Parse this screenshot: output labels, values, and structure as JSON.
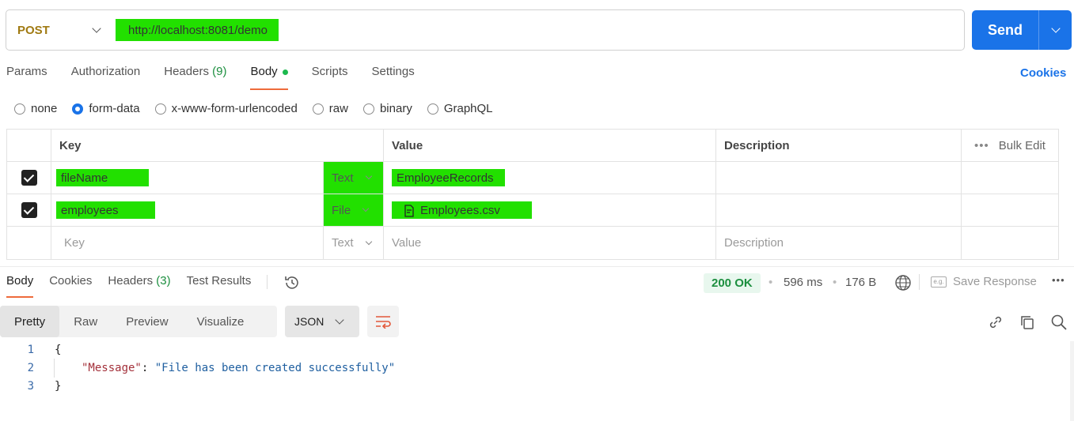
{
  "request": {
    "method": "POST",
    "url": "http://localhost:8081/demo",
    "send_label": "Send"
  },
  "tabs": [
    {
      "label": "Params"
    },
    {
      "label": "Authorization"
    },
    {
      "label": "Headers",
      "count": "(9)"
    },
    {
      "label": "Body",
      "active": true
    },
    {
      "label": "Scripts"
    },
    {
      "label": "Settings"
    }
  ],
  "cookies_label": "Cookies",
  "body_types": [
    "none",
    "form-data",
    "x-www-form-urlencoded",
    "raw",
    "binary",
    "GraphQL"
  ],
  "body_type_selected": "form-data",
  "form_table": {
    "headers": {
      "key": "Key",
      "value": "Value",
      "description": "Description",
      "bulk_edit": "Bulk Edit"
    },
    "rows": [
      {
        "key": "fileName",
        "type": "Text",
        "value": "EmployeeRecords",
        "checked": true
      },
      {
        "key": "employees",
        "type": "File",
        "value": "Employees.csv",
        "checked": true
      }
    ],
    "placeholder": {
      "key": "Key",
      "type": "Text",
      "value": "Value",
      "description": "Description"
    }
  },
  "response": {
    "tabs": [
      {
        "label": "Body",
        "active": true
      },
      {
        "label": "Cookies"
      },
      {
        "label": "Headers",
        "count": "(3)"
      },
      {
        "label": "Test Results"
      }
    ],
    "status": "200 OK",
    "time": "596 ms",
    "size": "176 B",
    "save_label": "Save Response",
    "eg_label": "e.g.",
    "view_tabs": [
      "Pretty",
      "Raw",
      "Preview",
      "Visualize"
    ],
    "format": "JSON",
    "code": {
      "line1": "{",
      "line2_key": "\"Message\"",
      "line2_colon": ": ",
      "line2_value": "\"File has been created successfully\"",
      "line3": "}",
      "numbers": [
        "1",
        "2",
        "3"
      ]
    }
  },
  "colors": {
    "accent": "#1a73e8",
    "highlight": "#22e000",
    "method": "#a07a12",
    "success": "#1c8f3f",
    "tab_underline": "#ee6b3b"
  }
}
